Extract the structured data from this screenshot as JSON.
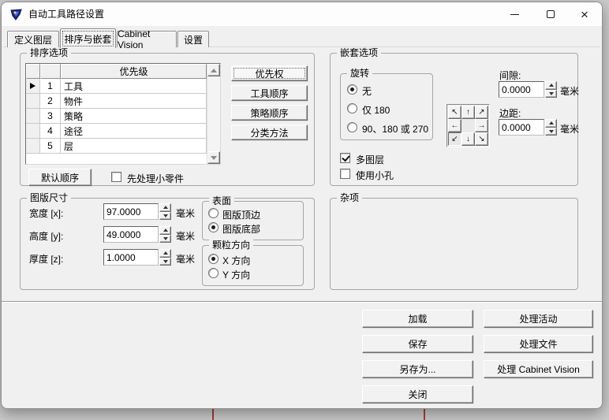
{
  "window": {
    "title": "自动工具路径设置"
  },
  "icons": {
    "close_glyph": "×"
  },
  "tabs": [
    {
      "label": "定义图层",
      "selected": false
    },
    {
      "label": "排序与嵌套",
      "selected": true
    },
    {
      "label": "Cabinet Vision",
      "selected": false
    },
    {
      "label": "设置",
      "selected": false
    }
  ],
  "sort_options": {
    "title": "排序选项",
    "table": {
      "header": "优先级",
      "rows": [
        {
          "num": "1",
          "label": "工具"
        },
        {
          "num": "2",
          "label": "物件"
        },
        {
          "num": "3",
          "label": "策略"
        },
        {
          "num": "4",
          "label": "途径"
        },
        {
          "num": "5",
          "label": "层"
        }
      ]
    },
    "buttons": {
      "priority": "优先权",
      "tool_order": "工具顺序",
      "strategy_order": "策略顺序",
      "sort_method": "分类方法"
    },
    "default_order": "默认顺序",
    "small_parts_first": {
      "label": "先处理小零件",
      "checked": false
    }
  },
  "nesting_options": {
    "title": "嵌套选项",
    "rotation": {
      "title": "旋转",
      "options": [
        {
          "label": "无",
          "selected": true
        },
        {
          "label": "仅 180",
          "selected": false
        },
        {
          "label": "90、180 或 270",
          "selected": false
        }
      ]
    },
    "direction_pad": [
      "↖",
      "↑",
      "↗",
      "←",
      "→",
      "↙",
      "↓",
      "↘"
    ],
    "gap": {
      "label": "间隙:",
      "value": "0.0000",
      "unit": "毫米"
    },
    "margin": {
      "label": "边距:",
      "value": "0.0000",
      "unit": "毫米"
    },
    "multi_layer": {
      "label": "多图层",
      "checked": true
    },
    "use_small_holes": {
      "label": "使用小孔",
      "checked": false
    }
  },
  "board_size": {
    "title": "图版尺寸",
    "width": {
      "label": "宽度 [x]:",
      "value": "97.0000",
      "unit": "毫米"
    },
    "height": {
      "label": "高度 [y]:",
      "value": "49.0000",
      "unit": "毫米"
    },
    "thickness": {
      "label": "厚度 [z]:",
      "value": "1.0000",
      "unit": "毫米"
    },
    "surface": {
      "title": "表面",
      "options": [
        {
          "label": "图版顶边",
          "selected": false
        },
        {
          "label": "图版底部",
          "selected": true
        }
      ]
    },
    "grain": {
      "title": "颗粒方向",
      "options": [
        {
          "label": "X 方向",
          "selected": true
        },
        {
          "label": "Y 方向",
          "selected": false
        }
      ]
    }
  },
  "misc": {
    "title": "杂项"
  },
  "actions": {
    "load": "加载",
    "process_active": "处理活动",
    "save": "保存",
    "process_file": "处理文件",
    "save_as": "另存为...",
    "process_cabinet_vision": "处理 Cabinet Vision",
    "close": "关闭"
  }
}
